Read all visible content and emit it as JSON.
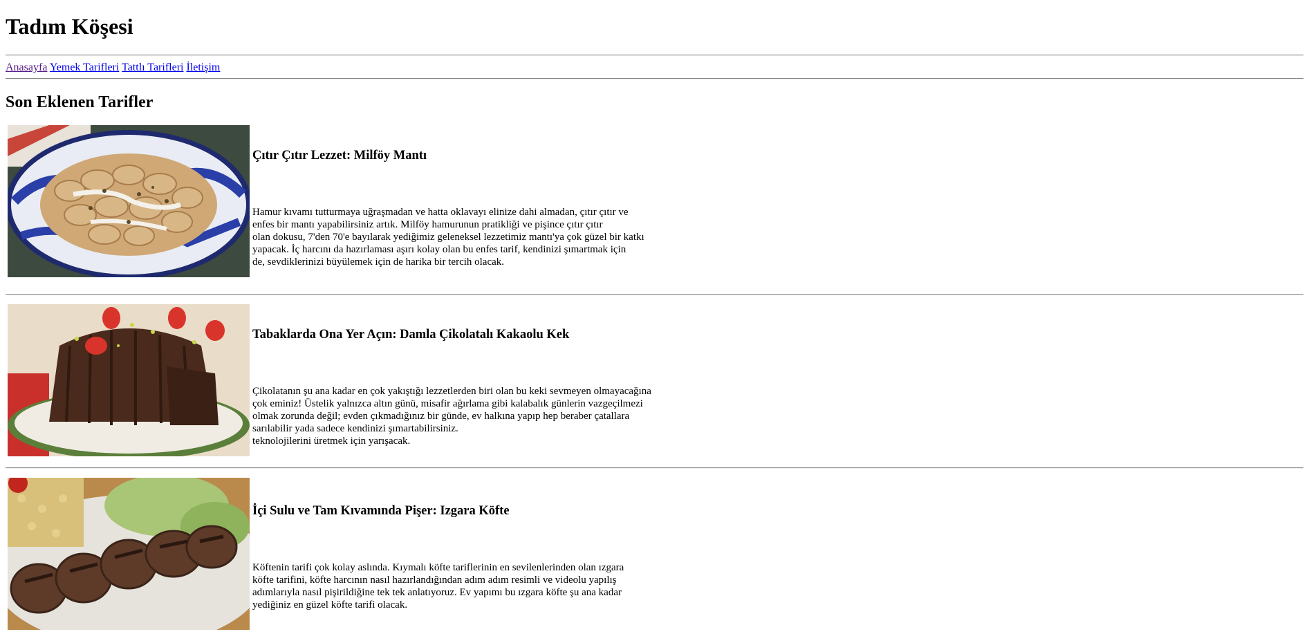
{
  "header": {
    "title": "Tadım Köşesi"
  },
  "nav": {
    "items": [
      {
        "label": "Anasayfa"
      },
      {
        "label": "Yemek Tarifleri"
      },
      {
        "label": "Tattlı Tarifleri"
      },
      {
        "label": "İletişim"
      }
    ]
  },
  "main": {
    "section_title": "Son Eklenen Tarifler",
    "recipes": [
      {
        "title": "Çıtır Çıtır Lezzet: Milföy Mantı",
        "description": "Hamur kıvamı tutturmaya uğraşmadan ve hatta oklavayı elinize dahi almadan, çıtır çıtır ve\nenfes bir mantı yapabilirsiniz artık. Milföy hamurunun pratikliği ve pişince çıtır çıtır\nolan dokusu, 7'den 70'e bayılarak yediğimiz geleneksel lezzetimiz mantı'ya çok güzel bir katkı\nyapacak. İç harcını da hazırlaması aşırı kolay olan bu enfes tarif, kendinizi şımartmak için\nde, sevdiklerinizi büyülemek için de harika bir tercih olacak.",
        "image": "milfoy-manti-photo"
      },
      {
        "title": "Tabaklarda Ona Yer Açın: Damla Çikolatalı Kakaolu Kek",
        "description": "Çikolatanın şu ana kadar en çok yakıştığı lezzetlerden biri olan bu keki sevmeyen olmayacağına\nçok eminiz! Üstelik yalnızca altın günü, misafir ağırlama gibi kalabalık günlerin vazgeçilmezi\nolmak zorunda değil; evden çıkmadığınız bir günde, ev halkına yapıp hep beraber çatallara\nsarılabilir yada sadece kendinizi şımartabilirsiniz.\nteknolojilerini üretmek için yarışacak.",
        "image": "kakaolu-kek-photo"
      },
      {
        "title": "İçi Sulu ve Tam Kıvamında Pişer: Izgara Köfte",
        "description": "Köftenin tarifi çok kolay aslında. Kıymalı köfte tariflerinin en sevilenlerinden olan ızgara\nköfte tarifini, köfte harcının nasıl hazırlandığından adım adım resimli ve videolu yapılış\nadımlarıyla nasıl pişirildiğine tek tek anlatıyoruz. Ev yapımı bu ızgara köfte şu ana kadar\nyediğiniz en güzel köfte tarifi olacak.",
        "image": "izgara-kofte-photo"
      }
    ]
  },
  "colors": {
    "link": "#0000ee",
    "visited_link": "#551a8b",
    "rule": "#888888"
  }
}
